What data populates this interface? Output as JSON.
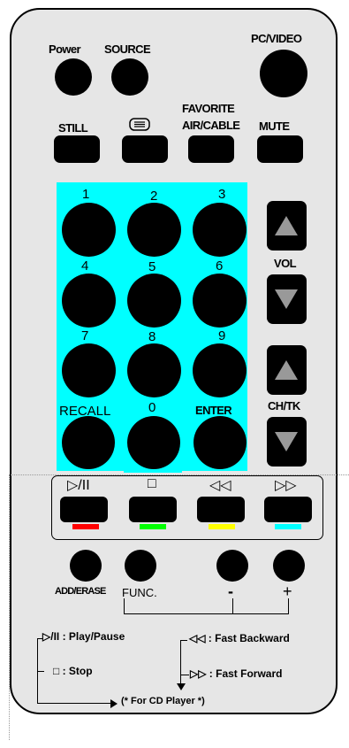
{
  "top": {
    "power_label": "Power",
    "source_label": "SOURCE",
    "pcvideo_label": "PC/VIDEO"
  },
  "row2": {
    "still_label": "STILL",
    "teletext_icon": "teletext-icon",
    "favorite_label": "FAVORITE",
    "aircable_label": "AIR/CABLE",
    "mute_label": "MUTE"
  },
  "keypad": {
    "keys": [
      "1",
      "2",
      "3",
      "4",
      "5",
      "6",
      "7",
      "8",
      "9",
      "0"
    ],
    "recall_label": "RECALL",
    "enter_label": "ENTER"
  },
  "side": {
    "vol_label": "VOL",
    "chtk_label": "CH/TK"
  },
  "transport": {
    "symbols": [
      "▷/II",
      "□",
      "◁◁",
      "▷▷"
    ],
    "colors": [
      "#ff0000",
      "#00ff00",
      "#ffff00",
      "#00ffff"
    ]
  },
  "bottom": {
    "adderase_label": "ADD/ERASE",
    "func_label": "FUNC.",
    "minus_label": "-",
    "plus_label": "+"
  },
  "legend": {
    "play_pause": "▷/II : Play/Pause",
    "stop": "□   : Stop",
    "fast_backward": "◁◁ : Fast Backward",
    "fast_forward": "▷▷ : Fast Forward",
    "cd_note": "(* For CD Player *)"
  }
}
